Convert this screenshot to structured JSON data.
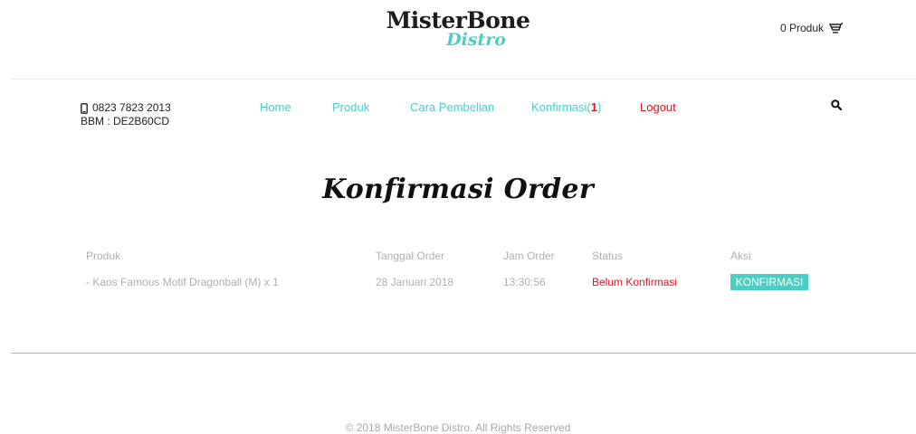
{
  "brand": {
    "name": "MisterBone",
    "sub": "Distro"
  },
  "cart": {
    "label": "0 Produk",
    "icon": "cart-icon"
  },
  "contact": {
    "phone": "0823 7823 2013",
    "bbm": "BBM : DE2B60CD",
    "phone_icon": "phone-icon"
  },
  "nav": {
    "home": "Home",
    "produk": "Produk",
    "cara": "Cara Pembelian",
    "konfirmasi": "Konfirmasi(",
    "konfirmasi_count": "1",
    "konfirmasi_close": ")",
    "logout": "Logout",
    "search_icon": "search-icon"
  },
  "page": {
    "title": "Konfirmasi Order"
  },
  "table": {
    "headers": [
      "Produk",
      "Tanggal Order",
      "Jam Order",
      "Status",
      "Aksi"
    ],
    "rows": [
      {
        "produk": "- Kaos Famous Motif Dragonball (M) x 1",
        "tanggal": "28 Januari 2018",
        "jam": "13:30:56",
        "status": "Belum Konfirmasi",
        "aksi": "KONFIRMASI"
      }
    ]
  },
  "footer": {
    "text": "© 2018 MisterBone Distro. All Rights Reserved"
  },
  "colors": {
    "accent": "#4ecdc4",
    "danger": "#e8121c",
    "muted": "#b0b0b0"
  }
}
